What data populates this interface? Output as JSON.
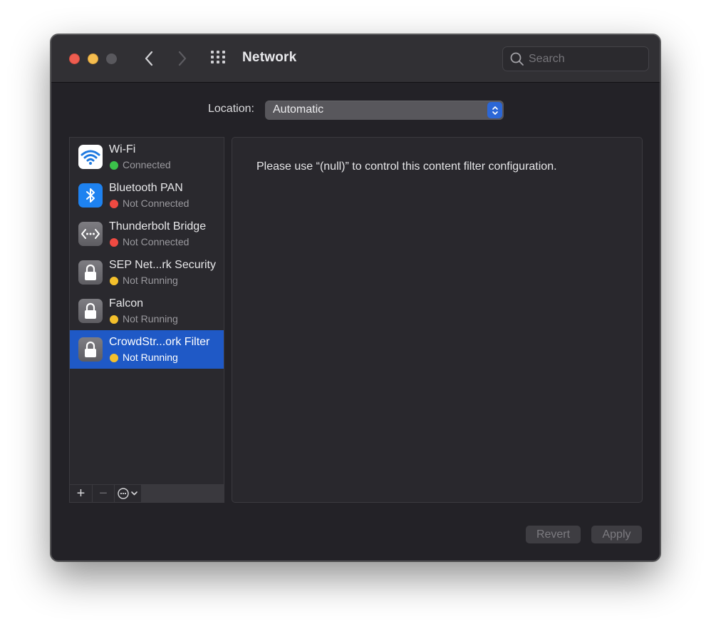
{
  "window": {
    "title": "Network"
  },
  "toolbar": {
    "back_icon": "chevron-left-icon",
    "forward_icon": "chevron-right-icon",
    "grid_icon": "show-all-grid-icon"
  },
  "search": {
    "placeholder": "Search",
    "value": ""
  },
  "location": {
    "label": "Location:",
    "selected": "Automatic"
  },
  "services": [
    {
      "name": "Wi-Fi",
      "status": "Connected",
      "status_color": "#3bc24a",
      "icon": "wifi-icon",
      "selected": false
    },
    {
      "name": "Bluetooth PAN",
      "status": "Not Connected",
      "status_color": "#ef4a42",
      "icon": "bluetooth-icon",
      "selected": false
    },
    {
      "name": "Thunderbolt Bridge",
      "status": "Not Connected",
      "status_color": "#ef4a42",
      "icon": "thunderbolt-bridge-icon",
      "selected": false
    },
    {
      "name": "SEP Net...rk Security",
      "status": "Not Running",
      "status_color": "#f4c02c",
      "icon": "lock-icon",
      "selected": false
    },
    {
      "name": "Falcon",
      "status": "Not Running",
      "status_color": "#f4c02c",
      "icon": "lock-icon",
      "selected": false
    },
    {
      "name": "CrowdStr...ork Filter",
      "status": "Not Running",
      "status_color": "#f4c02c",
      "icon": "lock-icon",
      "selected": true
    }
  ],
  "sidebar_toolbar": {
    "add_label": "+",
    "remove_label": "−"
  },
  "detail": {
    "message": "Please use “(null)” to control this content filter configuration."
  },
  "buttons": {
    "revert": "Revert",
    "apply": "Apply"
  },
  "colors": {
    "accent": "#1f59c6",
    "window_bg": "#232227"
  }
}
